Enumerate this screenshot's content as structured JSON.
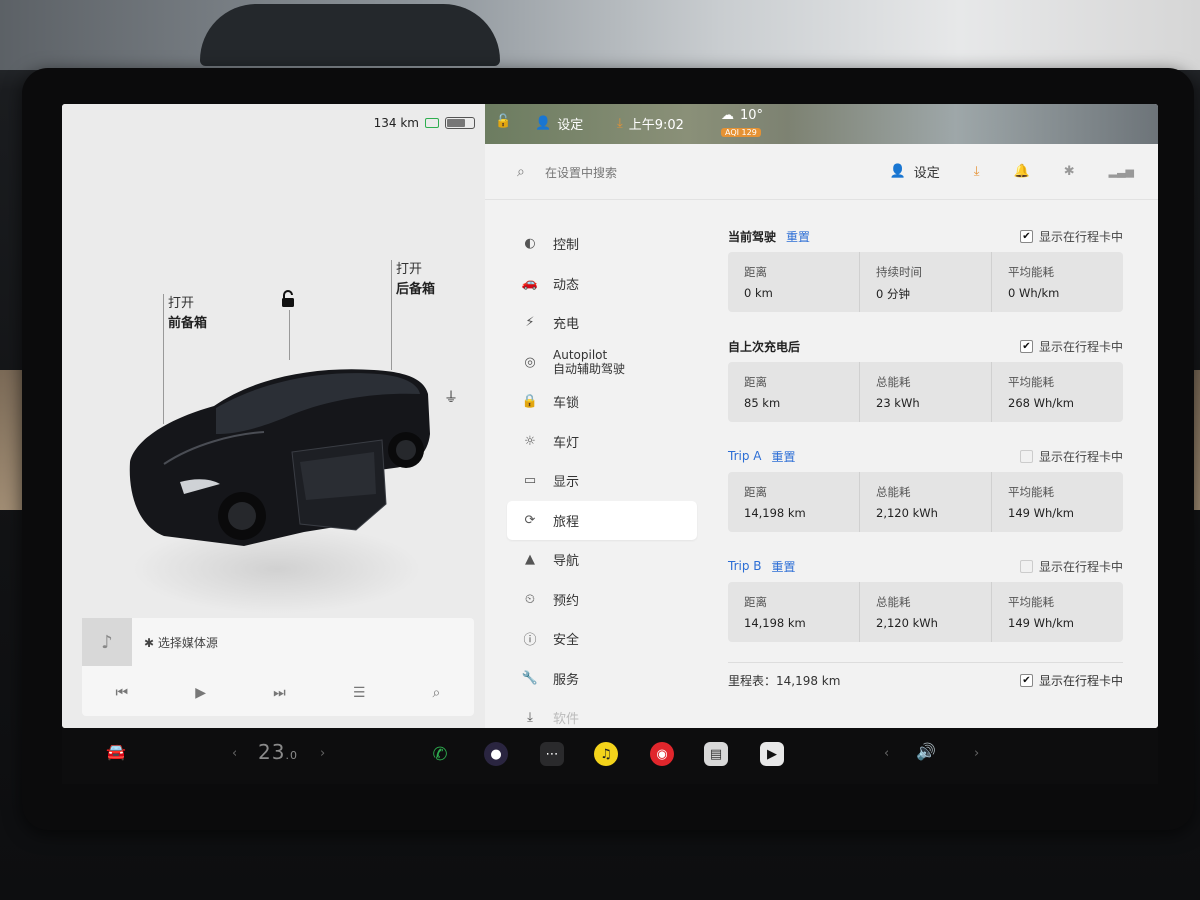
{
  "car_panel": {
    "range": "134 km",
    "frunk": {
      "line1": "打开",
      "line2": "前备箱"
    },
    "trunk": {
      "line1": "打开",
      "line2": "后备箱"
    },
    "battery_level": 0.7
  },
  "media": {
    "source": "选择媒体源"
  },
  "top_strip": {
    "profile": "设定",
    "time": "上午9:02",
    "temperature": "10°",
    "aqi": "AQI 129"
  },
  "settings": {
    "search_placeholder": "在设置中搜索",
    "profile_label": "设定",
    "menu": [
      {
        "label": "控制",
        "icon": "toggle-icon"
      },
      {
        "label": "动态",
        "icon": "car-icon"
      },
      {
        "label": "充电",
        "icon": "bolt-icon"
      },
      {
        "label": "Autopilot",
        "sub": "自动辅助驾驶",
        "icon": "steering-wheel-icon"
      },
      {
        "label": "车锁",
        "icon": "lock-icon"
      },
      {
        "label": "车灯",
        "icon": "light-icon"
      },
      {
        "label": "显示",
        "icon": "display-icon"
      },
      {
        "label": "旅程",
        "icon": "trip-icon"
      },
      {
        "label": "导航",
        "icon": "navigation-icon"
      },
      {
        "label": "预约",
        "icon": "clock-icon"
      },
      {
        "label": "安全",
        "icon": "safety-icon"
      },
      {
        "label": "服务",
        "icon": "wrench-icon"
      },
      {
        "label": "软件",
        "icon": "download-icon"
      }
    ],
    "show_in_card": "显示在行程卡中",
    "reset": "重置",
    "sections": [
      {
        "title": "当前驾驶",
        "has_reset": true,
        "checked": true,
        "stats": [
          {
            "label": "距离",
            "value": "0 km"
          },
          {
            "label": "持续时间",
            "value": "0 分钟"
          },
          {
            "label": "平均能耗",
            "value": "0 Wh/km"
          }
        ]
      },
      {
        "title": "自上次充电后",
        "has_reset": false,
        "checked": true,
        "stats": [
          {
            "label": "距离",
            "value": "85 km"
          },
          {
            "label": "总能耗",
            "value": "23 kWh"
          },
          {
            "label": "平均能耗",
            "value": "268 Wh/km"
          }
        ]
      },
      {
        "title": "Trip A",
        "has_reset": true,
        "checked": false,
        "stats": [
          {
            "label": "距离",
            "value": "14,198 km"
          },
          {
            "label": "总能耗",
            "value": "2,120 kWh"
          },
          {
            "label": "平均能耗",
            "value": "149 Wh/km"
          }
        ]
      },
      {
        "title": "Trip B",
        "has_reset": true,
        "checked": false,
        "stats": [
          {
            "label": "距离",
            "value": "14,198 km"
          },
          {
            "label": "总能耗",
            "value": "2,120 kWh"
          },
          {
            "label": "平均能耗",
            "value": "149 Wh/km"
          }
        ]
      }
    ],
    "odometer": "里程表：14,198 km",
    "odometer_checked": true
  },
  "taskbar": {
    "temp_main": "23",
    "temp_decimal": ".0"
  },
  "colors": {
    "accent": "#2c6ed5",
    "aqi": "#e59234",
    "phone": "#2eae4f",
    "music": "#f3d31b",
    "netease": "#e0262c"
  }
}
